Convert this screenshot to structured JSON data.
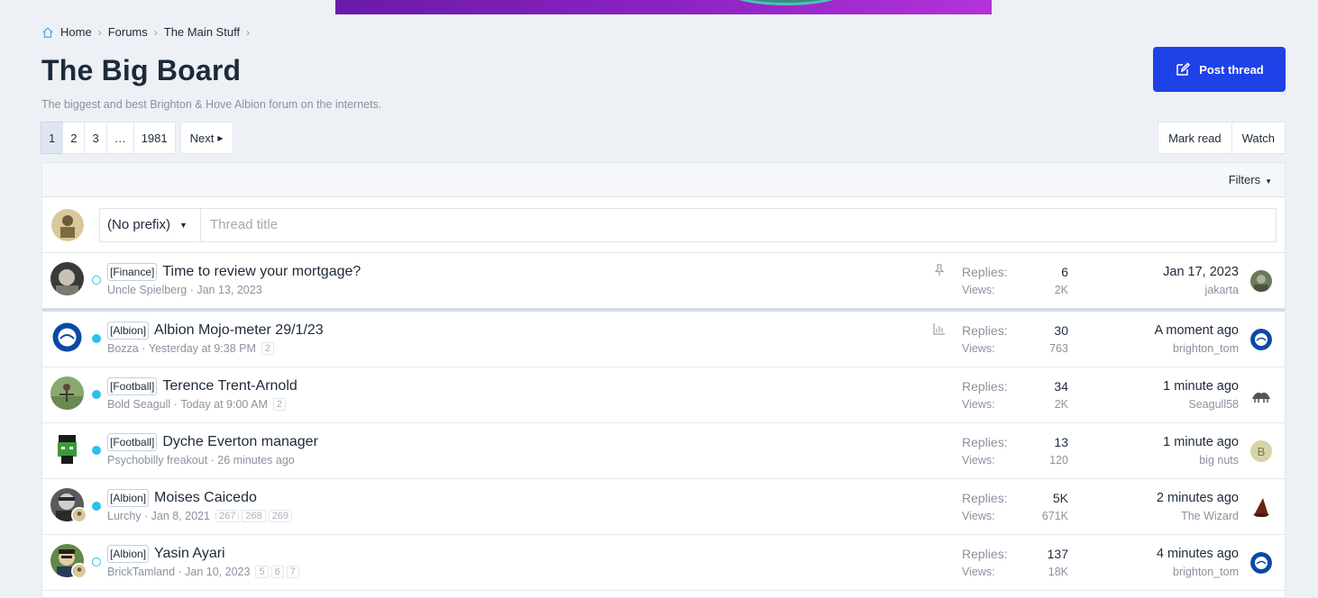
{
  "breadcrumb": {
    "items": [
      "Home",
      "Forums",
      "The Main Stuff"
    ]
  },
  "page": {
    "title": "The Big Board",
    "description": "The biggest and best Brighton & Hove Albion forum on the internets."
  },
  "post_thread": {
    "label": "Post thread",
    "icon": "edit-icon"
  },
  "pagination": {
    "pages": [
      "1",
      "2",
      "3",
      "…",
      "1981"
    ],
    "next": "Next"
  },
  "actions": {
    "mark_read": "Mark read",
    "watch": "Watch"
  },
  "filters": {
    "label": "Filters"
  },
  "new_thread": {
    "prefix": "(No prefix)",
    "placeholder": "Thread title"
  },
  "colors": {
    "accent": "#1f42e8",
    "unread_dot": "#2cc0ec",
    "background": "#edf0f5"
  },
  "threads": [
    {
      "prefix": "[Finance]",
      "title": "Time to review your mortgage?",
      "author": "Uncle Spielberg",
      "date": "Jan 13, 2023",
      "pages": [],
      "status_icon": "pin-icon",
      "replies_label": "Replies:",
      "replies": "6",
      "views_label": "Views:",
      "views": "2K",
      "last_when": "Jan 17, 2023",
      "last_who": "jakarta",
      "unread": false
    },
    {
      "prefix": "[Albion]",
      "title": "Albion Mojo-meter 29/1/23",
      "author": "Bozza",
      "date": "Yesterday at 9:38 PM",
      "pages": [
        "2"
      ],
      "status_icon": "poll-icon",
      "replies_label": "Replies:",
      "replies": "30",
      "views_label": "Views:",
      "views": "763",
      "last_when": "A moment ago",
      "last_who": "brighton_tom",
      "unread": true
    },
    {
      "prefix": "[Football]",
      "title": "Terence Trent-Arnold",
      "author": "Bold Seagull",
      "date": "Today at 9:00 AM",
      "pages": [
        "2"
      ],
      "status_icon": "",
      "replies_label": "Replies:",
      "replies": "34",
      "views_label": "Views:",
      "views": "2K",
      "last_when": "1 minute ago",
      "last_who": "Seagull58",
      "unread": true
    },
    {
      "prefix": "[Football]",
      "title": "Dyche Everton manager",
      "author": "Psychobilly freakout",
      "date": "26 minutes ago",
      "pages": [],
      "status_icon": "",
      "replies_label": "Replies:",
      "replies": "13",
      "views_label": "Views:",
      "views": "120",
      "last_when": "1 minute ago",
      "last_who": "big nuts",
      "last_initial": "B",
      "unread": true
    },
    {
      "prefix": "[Albion]",
      "title": "Moises Caicedo",
      "author": "Lurchy",
      "date": "Jan 8, 2021",
      "pages": [
        "267",
        "268",
        "269"
      ],
      "status_icon": "",
      "replies_label": "Replies:",
      "replies": "5K",
      "views_label": "Views:",
      "views": "671K",
      "last_when": "2 minutes ago",
      "last_who": "The Wizard",
      "unread": true
    },
    {
      "prefix": "[Albion]",
      "title": "Yasin Ayari",
      "author": "BrickTamland",
      "date": "Jan 10, 2023",
      "pages": [
        "5",
        "6",
        "7"
      ],
      "status_icon": "",
      "replies_label": "Replies:",
      "replies": "137",
      "views_label": "Views:",
      "views": "18K",
      "last_when": "4 minutes ago",
      "last_who": "brighton_tom",
      "unread": false
    }
  ]
}
